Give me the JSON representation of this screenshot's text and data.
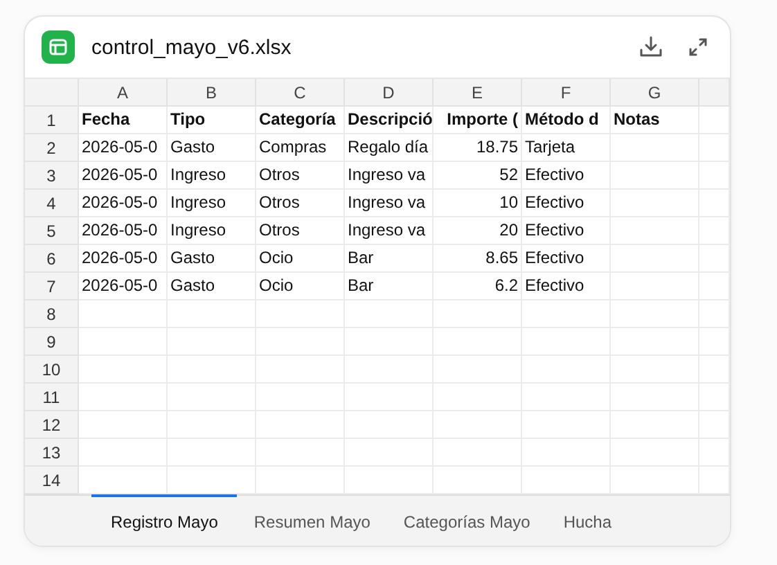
{
  "file": {
    "name": "control_mayo_v6.xlsx"
  },
  "columns": [
    {
      "letter": "A",
      "numeric": false
    },
    {
      "letter": "B",
      "numeric": false
    },
    {
      "letter": "C",
      "numeric": false
    },
    {
      "letter": "D",
      "numeric": false
    },
    {
      "letter": "E",
      "numeric": true
    },
    {
      "letter": "F",
      "numeric": false
    },
    {
      "letter": "G",
      "numeric": false
    }
  ],
  "header_row": {
    "number": "1",
    "cells": [
      "Fecha",
      "Tipo",
      "Categoría",
      "Descripció",
      "Importe (",
      "Método d",
      "Notas"
    ]
  },
  "rows": [
    {
      "number": "2",
      "cells": [
        "2026-05-0",
        "Gasto",
        "Compras",
        "Regalo día",
        "18.75",
        "Tarjeta"
      ]
    },
    {
      "number": "3",
      "cells": [
        "2026-05-0",
        "Ingreso",
        "Otros",
        "Ingreso va",
        "52",
        "Efectivo"
      ]
    },
    {
      "number": "4",
      "cells": [
        "2026-05-0",
        "Ingreso",
        "Otros",
        "Ingreso va",
        "10",
        "Efectivo"
      ]
    },
    {
      "number": "5",
      "cells": [
        "2026-05-0",
        "Ingreso",
        "Otros",
        "Ingreso va",
        "20",
        "Efectivo"
      ]
    },
    {
      "number": "6",
      "cells": [
        "2026-05-0",
        "Gasto",
        "Ocio",
        "Bar",
        "8.65",
        "Efectivo"
      ]
    },
    {
      "number": "7",
      "cells": [
        "2026-05-0",
        "Gasto",
        "Ocio",
        "Bar",
        "6.2",
        "Efectivo"
      ]
    },
    {
      "number": "8"
    },
    {
      "number": "9"
    },
    {
      "number": "10"
    },
    {
      "number": "11"
    },
    {
      "number": "12"
    },
    {
      "number": "13"
    },
    {
      "number": "14"
    }
  ],
  "sheets": [
    {
      "label": "Registro Mayo",
      "selected": true
    },
    {
      "label": "Resumen Mayo",
      "selected": false
    },
    {
      "label": "Categorías Mayo",
      "selected": false
    },
    {
      "label": "Hucha",
      "selected": false
    }
  ]
}
